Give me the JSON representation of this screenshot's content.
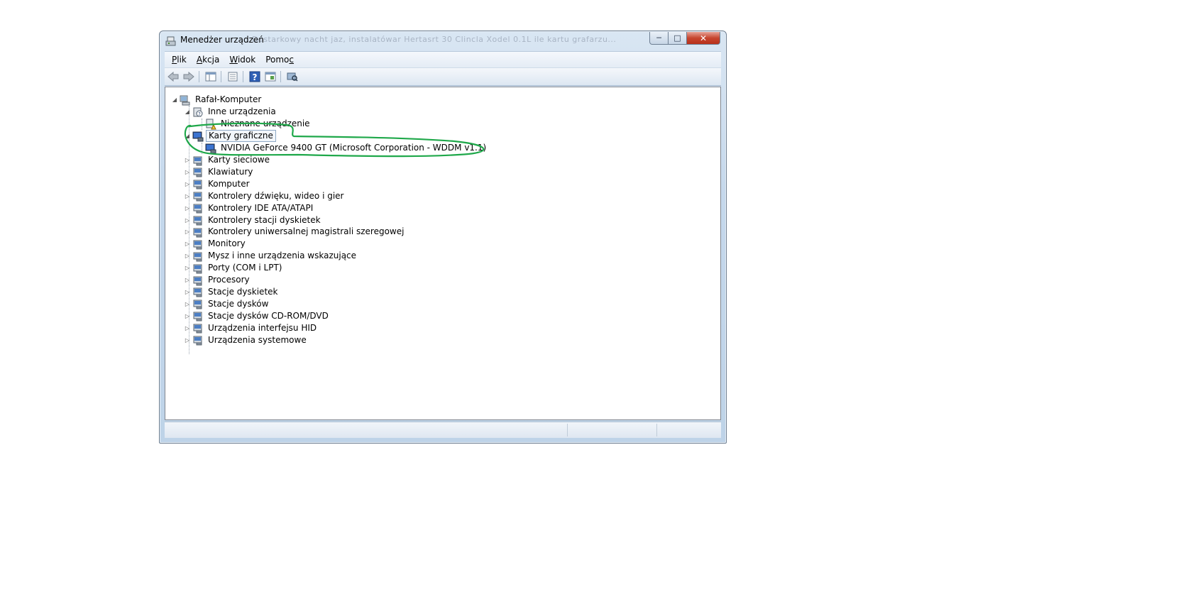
{
  "window": {
    "title": "Menedżer urządzeń",
    "blurred_background_text": "Dostarkowy nacht   jaz, instalatówar   Hertasrt 30 Clincla Xodel 0.1L ile kartu grafarzu..."
  },
  "menubar": {
    "items": [
      {
        "pre": "",
        "ul": "P",
        "post": "lik"
      },
      {
        "pre": "",
        "ul": "A",
        "post": "kcja"
      },
      {
        "pre": "",
        "ul": "W",
        "post": "idok"
      },
      {
        "pre": "Pomo",
        "ul": "c",
        "post": ""
      }
    ]
  },
  "toolbar": {
    "icons": [
      "back-icon",
      "forward-icon",
      "show-hide-console-tree-icon",
      "properties-icon",
      "help-icon",
      "console-tree-icon",
      "scan-hardware-icon"
    ]
  },
  "tree": {
    "root": "Rafał-Komputer",
    "inne": "Inne urządzenia",
    "nieznane": "Nieznane urządzenie",
    "karty_graficzne": "Karty graficzne",
    "nvidia": "NVIDIA GeForce 9400 GT (Microsoft Corporation - WDDM v1.1)",
    "categories": [
      "Karty sieciowe",
      "Klawiatury",
      "Komputer",
      "Kontrolery dźwięku, wideo i gier",
      "Kontrolery IDE ATA/ATAPI",
      "Kontrolery stacji dyskietek",
      "Kontrolery uniwersalnej magistrali szeregowej",
      "Monitory",
      "Mysz i inne urządzenia wskazujące",
      "Porty (COM i LPT)",
      "Procesory",
      "Stacje dyskietek",
      "Stacje dysków",
      "Stacje dysków CD-ROM/DVD",
      "Urządzenia interfejsu HID",
      "Urządzenia systemowe"
    ]
  },
  "colors": {
    "highlight_stroke": "#1fa84a",
    "window_frame": "#c5d8ec",
    "close_button": "#c7462f"
  }
}
